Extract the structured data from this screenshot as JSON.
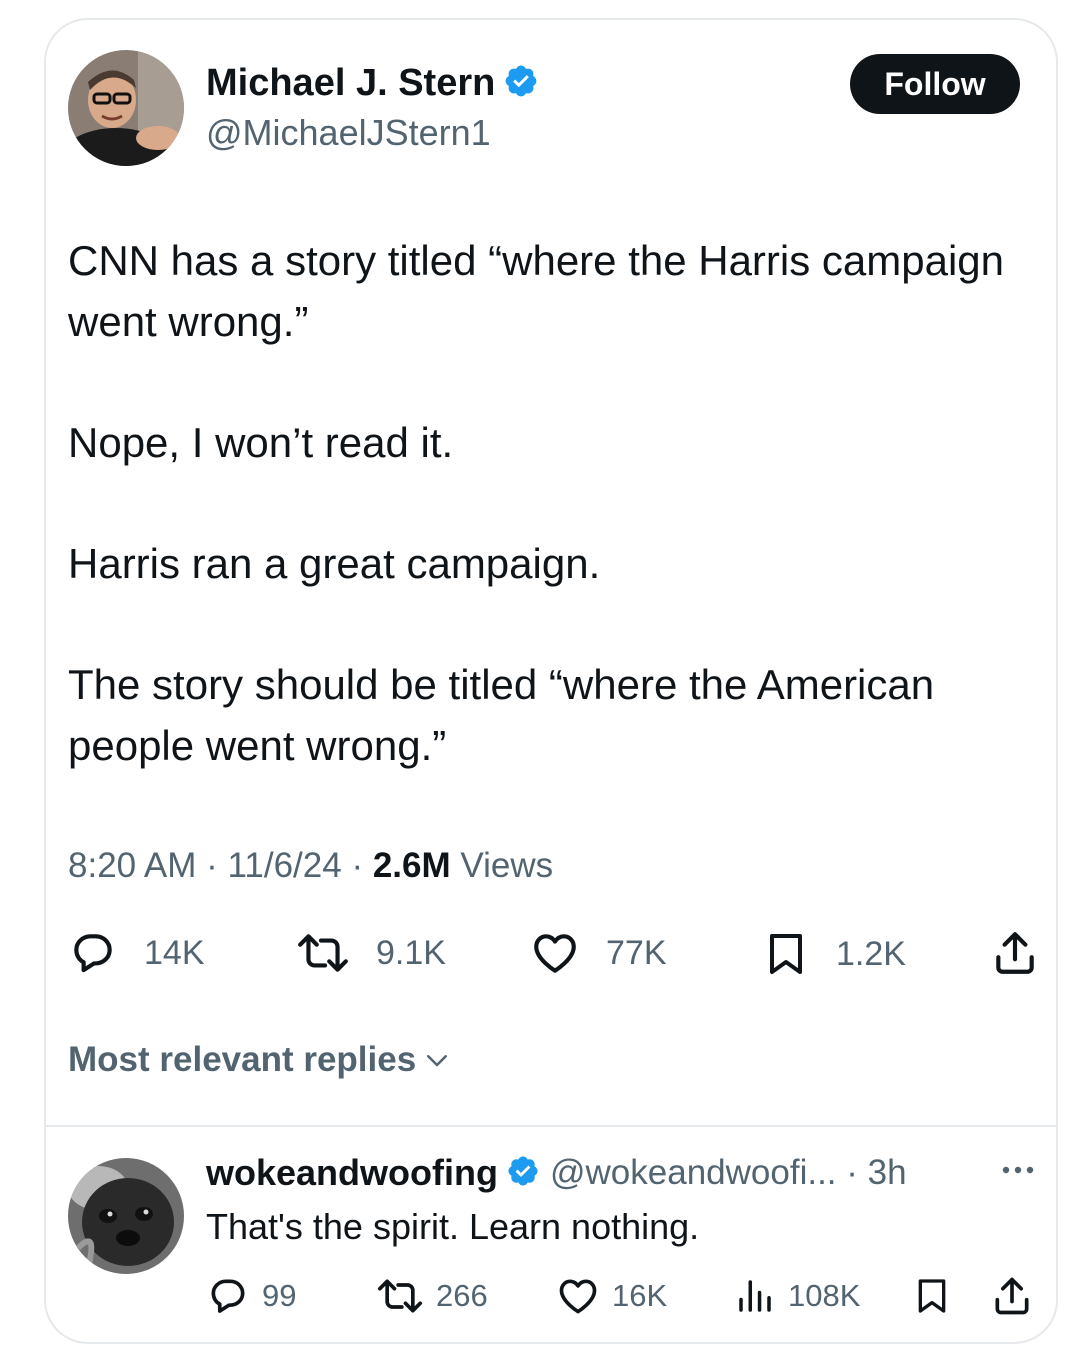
{
  "tweet": {
    "author": {
      "display_name": "Michael J. Stern",
      "handle": "@MichaelJStern1",
      "verified": true
    },
    "follow_label": "Follow",
    "paragraphs": [
      "CNN has a story titled “where the Harris campaign went wrong.”",
      "Nope, I won’t read it.",
      "Harris ran a great campaign.",
      "The story should be titled “where the American people went wrong.”"
    ],
    "time": "8:20 AM",
    "date": "11/6/24",
    "separator": " · ",
    "views_count": "2.6M",
    "views_label": " Views",
    "stats": {
      "replies": "14K",
      "reposts": "9.1K",
      "likes": "77K",
      "bookmarks": "1.2K"
    }
  },
  "replies_section": {
    "label": "Most relevant replies"
  },
  "reply": {
    "display_name": "wokeandwoofing",
    "verified": true,
    "handle_time": "@wokeandwoofi... · 3h",
    "text": "That's the spirit. Learn nothing.",
    "stats": {
      "replies": "99",
      "reposts": "266",
      "likes": "16K",
      "views": "108K"
    }
  },
  "colors": {
    "text_primary": "#0f1419",
    "text_secondary": "#536471",
    "verified_blue": "#1d9bf0",
    "follow_bg": "#0f1419",
    "border": "#e6e9eb"
  },
  "icons": [
    "verified-badge-icon",
    "reply-icon",
    "repost-icon",
    "like-icon",
    "bookmark-icon",
    "share-icon",
    "chevron-down-icon",
    "more-icon",
    "views-icon"
  ]
}
